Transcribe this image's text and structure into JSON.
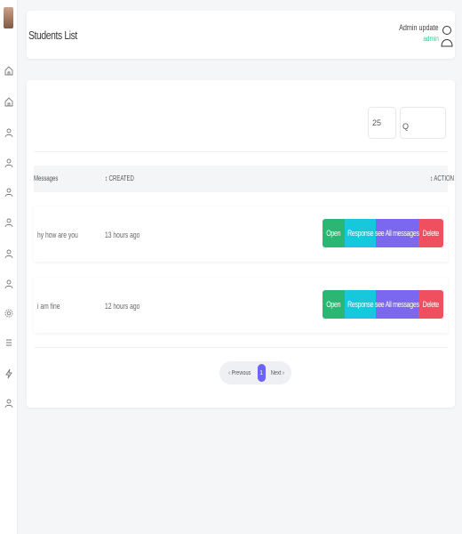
{
  "sidebar": {
    "icons": [
      "home-icon",
      "home-icon",
      "user-icon",
      "user-icon",
      "user-icon",
      "user-icon",
      "user-icon",
      "user-icon",
      "settings-icon",
      "menu-icon",
      "bolt-icon",
      "user-icon"
    ]
  },
  "header": {
    "title": "Students List",
    "user_name": "Admin update",
    "user_role": "admin"
  },
  "toolbar": {
    "page_size": "25",
    "search_value": "Q"
  },
  "table": {
    "columns": {
      "messages": "Messages",
      "created": "↕ CREATED",
      "action": "↕ ACTION"
    },
    "rows": [
      {
        "message": "hy how are you",
        "created": "13 hours ago"
      },
      {
        "message": "i am fine",
        "created": "12 hours ago"
      }
    ],
    "actions": {
      "open": "Open",
      "response": "Response",
      "see_all": "see All messages",
      "delete": "Delete"
    }
  },
  "pagination": {
    "previous": "‹ Previous",
    "current": "1",
    "next": "Next ›"
  },
  "colors": {
    "open": "#2ab773",
    "response": "#17c7dc",
    "see_all": "#7b68ee",
    "delete": "#ef4f5f",
    "pagination_active": "#6c63ff",
    "role": "#2ecc8f"
  }
}
